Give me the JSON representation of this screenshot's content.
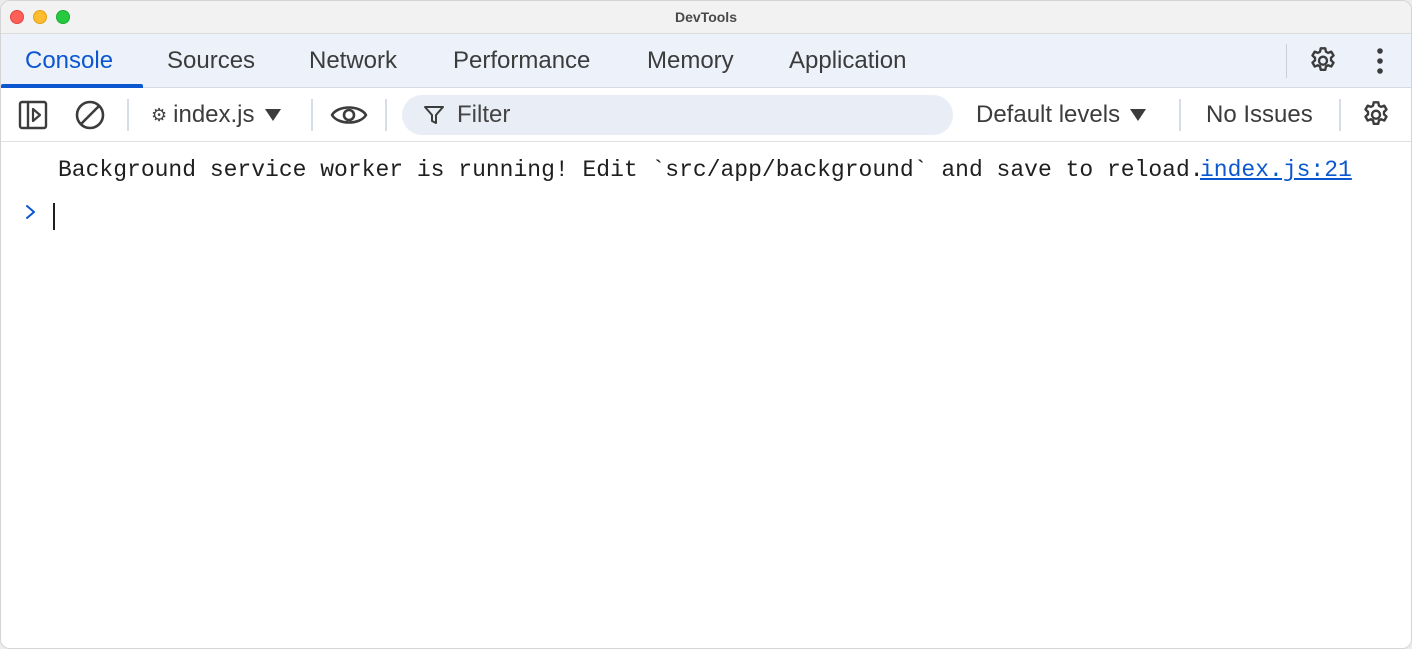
{
  "window": {
    "title": "DevTools"
  },
  "tabs": [
    {
      "label": "Console",
      "active": true
    },
    {
      "label": "Sources"
    },
    {
      "label": "Network"
    },
    {
      "label": "Performance"
    },
    {
      "label": "Memory"
    },
    {
      "label": "Application"
    }
  ],
  "tabbar_icons": [
    "gear-icon",
    "more-vertical-icon"
  ],
  "toolbar": {
    "context_label": "index.js",
    "filter_placeholder": "Filter",
    "levels_label": "Default levels",
    "issues_label": "No Issues"
  },
  "console": {
    "messages": [
      {
        "text": "Background service worker is running! Edit `src/app/background` and save to reload.",
        "source": "index.js:21"
      }
    ],
    "prompt_value": ""
  },
  "colors": {
    "accent": "#0b57d0",
    "tabbar_bg": "#edf2fa",
    "filter_bg": "#e9eef6"
  }
}
